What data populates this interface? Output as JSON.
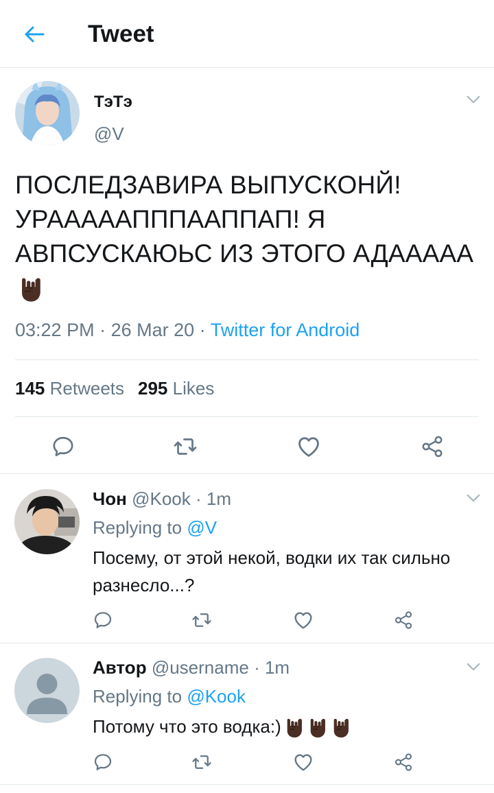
{
  "header": {
    "title": "Tweet",
    "back_icon": "arrow-left-icon",
    "accent_color": "#1da1f2"
  },
  "main_tweet": {
    "name": "ТэТэ",
    "handle": "@V",
    "text": "ПОСЛЕДЗАВИРА ВЫПУСКОНЙ! УРАААААПППААППАП! Я АВПСУСКАЮЬС ИЗ ЭТОГО АДААААА",
    "time": "03:22 PM",
    "date": "26 Mar 20",
    "source": "Twitter for Android",
    "retweets_count": "145",
    "retweets_label": "Retweets",
    "likes_count": "295",
    "likes_label": "Likes"
  },
  "replies": [
    {
      "name": "Чон",
      "handle": "@Kook",
      "time": "1m",
      "replying_prefix": "Replying to",
      "replying_to": "@V",
      "text": "Посему, от этой некой, водки их так сильно разнесло...?"
    },
    {
      "name": "Автор",
      "handle": "@username",
      "time": "1m",
      "replying_prefix": "Replying to",
      "replying_to": "@Kook",
      "text": "Потому что это водка:)"
    }
  ],
  "separators": {
    "dot": "·"
  },
  "icons": [
    "reply-icon",
    "retweet-icon",
    "like-icon",
    "share-icon",
    "chevron-down-icon",
    "horns-emoji"
  ],
  "colors": {
    "text": "#14171a",
    "secondary": "#657786",
    "link": "#1da1f2",
    "divider": "#e1e8ed"
  }
}
